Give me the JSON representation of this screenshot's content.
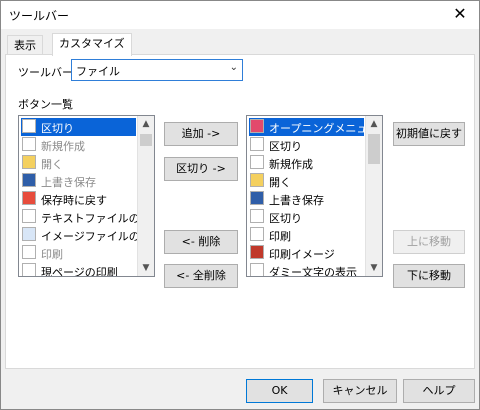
{
  "title": "ツールバー",
  "tabs": [
    {
      "label": "表示"
    },
    {
      "label": "カスタマイズ"
    }
  ],
  "toolbar_label": "ツールバー :",
  "toolbar_select": "ファイル",
  "buttons_section_label": "ボタン一覧",
  "left_list": [
    {
      "label": "区切り",
      "selected": true,
      "dim": false
    },
    {
      "label": "新規作成",
      "selected": false,
      "dim": true
    },
    {
      "label": "開く",
      "selected": false,
      "dim": true
    },
    {
      "label": "上書き保存",
      "selected": false,
      "dim": true
    },
    {
      "label": "保存時に戻す",
      "selected": false,
      "dim": false
    },
    {
      "label": "テキストファイルの読み込",
      "selected": false,
      "dim": false
    },
    {
      "label": "イメージファイルの読み込",
      "selected": false,
      "dim": false
    },
    {
      "label": "印刷",
      "selected": false,
      "dim": true
    },
    {
      "label": "現ページの印刷",
      "selected": false,
      "dim": false
    }
  ],
  "right_list": [
    {
      "label": "オープニングメニュー",
      "selected": true
    },
    {
      "label": "区切り",
      "selected": false
    },
    {
      "label": "新規作成",
      "selected": false
    },
    {
      "label": "開く",
      "selected": false
    },
    {
      "label": "上書き保存",
      "selected": false
    },
    {
      "label": "区切り",
      "selected": false
    },
    {
      "label": "印刷",
      "selected": false
    },
    {
      "label": "印刷イメージ",
      "selected": false
    },
    {
      "label": "ダミー文字の表示",
      "selected": false
    }
  ],
  "middle_buttons": {
    "add": "追加 ->",
    "separator": "区切り ->",
    "remove": "<- 削除",
    "remove_all": "<- 全削除"
  },
  "right_buttons": {
    "reset": "初期値に戻す",
    "move_up": "上に移動",
    "move_down": "下に移動"
  },
  "footer": {
    "ok": "OK",
    "cancel": "キャンセル",
    "help": "ヘルプ"
  }
}
